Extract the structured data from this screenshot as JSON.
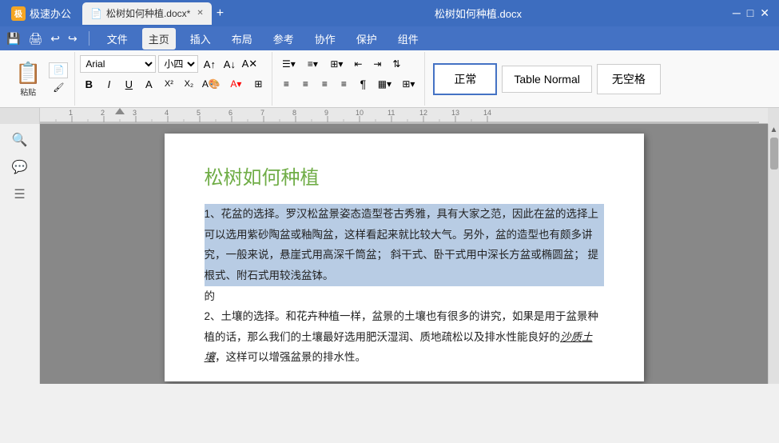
{
  "app": {
    "name": "极速办公",
    "logo_char": "极"
  },
  "tab": {
    "label": "松树如何种植.docx*",
    "icon": "📄"
  },
  "title_bar": {
    "title": "松树如何种植.docx"
  },
  "menu": {
    "items": [
      "文件",
      "主页",
      "插入",
      "布局",
      "参考",
      "协作",
      "保护",
      "组件"
    ],
    "active": "主页"
  },
  "quick_toolbar": {
    "buttons": [
      "💾",
      "🖨",
      "↩",
      "↪"
    ]
  },
  "ribbon": {
    "paste_label": "粘贴",
    "font_name": "Arial",
    "font_size": "小四",
    "format_buttons": [
      "B",
      "I",
      "U",
      "A",
      "X²",
      "X₂"
    ],
    "style_normal": "正常",
    "style_table_normal": "Table Normal",
    "style_no_space": "无空格"
  },
  "document": {
    "title": "松树如何种植",
    "content": [
      {
        "type": "selected",
        "text": "1、花盆的选择。罗汉松盆景姿态造型苍古秀雅，具有大家之范，因此在盆的选择上可以选用紫砂陶盆或釉陶盆，这样看起来就比较大气。另外，盆的造型也有颇多讲究，一般来说，悬崖式用高深千筒盆；  斜干式、卧干式用中深长方盆或椭圆盆；  提根式、附石式用较浅盆钵。"
      },
      {
        "type": "normal",
        "text": "的"
      },
      {
        "type": "normal",
        "text": "2、土壤的选择。和花卉种植一样，盆景的土壤也有很多的讲究，如果是用于盆景种植的话，那么我们的土壤最好选用肥沃湿润、质地疏松以及排水性能良好的沙质土壤，这样可以增强盆景的排水性。"
      }
    ],
    "underline_text": "沙质土壤"
  },
  "sidebar": {
    "icons": [
      "🔍",
      "💬",
      "☰"
    ]
  }
}
